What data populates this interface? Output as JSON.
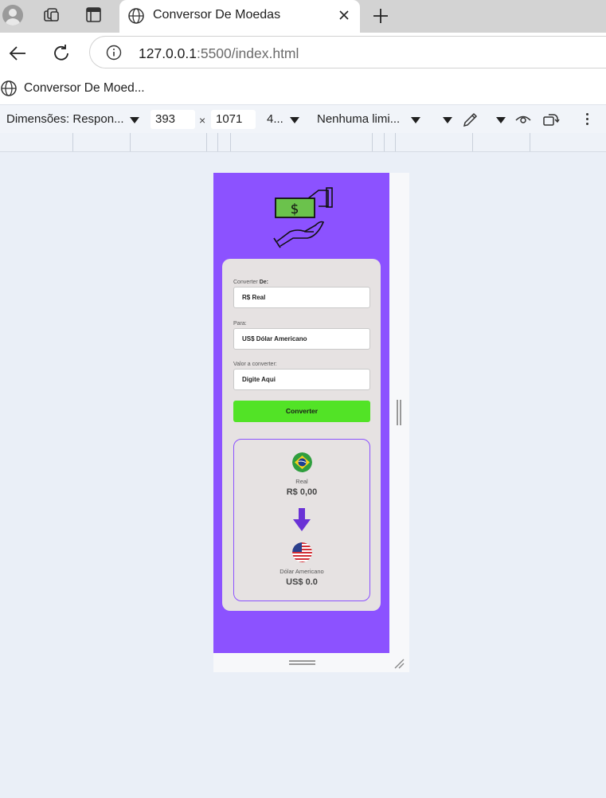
{
  "browser": {
    "tab": {
      "title": "Conversor De Moedas"
    },
    "address": {
      "host": "127.0.0.1",
      "rest": ":5500/index.html"
    },
    "favorites": [
      {
        "label": "Conversor De Moed..."
      }
    ]
  },
  "devtools": {
    "dimensions_label": "Dimensões: Respon...",
    "width": "393",
    "times": "×",
    "height": "1071",
    "zoom": "4...",
    "throttling": "Nenhuma limi..."
  },
  "app": {
    "brand_color": "#8c52ff",
    "button_color": "#52e326",
    "from_label_prefix": "Converter",
    "from_label_bold": "De:",
    "from_value": "R$ Real",
    "to_label": "Para:",
    "to_value": "US$ Dólar Americano",
    "amount_label": "Valor a converter:",
    "amount_placeholder": "Digite Aqui",
    "convert_button": "Converter",
    "result": {
      "from_currency": "Real",
      "from_amount": "R$ 0,00",
      "to_currency": "Dólar Americano",
      "to_amount": "US$ 0.0"
    },
    "icons": [
      "brazil-flag-icon",
      "usa-flag-icon",
      "arrow-down-icon",
      "money-hand-icon"
    ]
  }
}
